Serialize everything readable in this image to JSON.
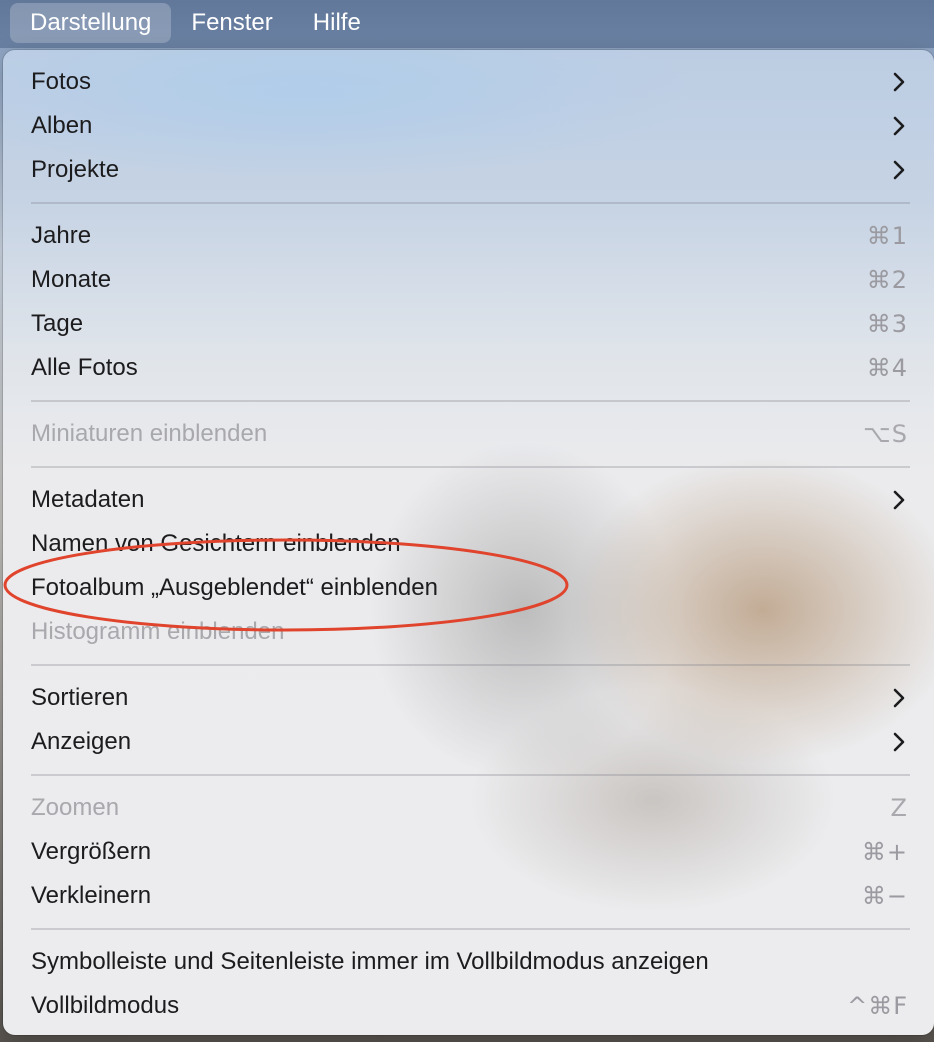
{
  "menubar": {
    "items": [
      {
        "label": "Darstellung"
      },
      {
        "label": "Fenster"
      },
      {
        "label": "Hilfe"
      }
    ]
  },
  "menu": {
    "items": [
      {
        "label": "Fotos",
        "submenu": true
      },
      {
        "label": "Alben",
        "submenu": true
      },
      {
        "label": "Projekte",
        "submenu": true
      },
      {
        "label": "Jahre",
        "shortcut": "⌘1"
      },
      {
        "label": "Monate",
        "shortcut": "⌘2"
      },
      {
        "label": "Tage",
        "shortcut": "⌘3"
      },
      {
        "label": "Alle Fotos",
        "shortcut": "⌘4"
      },
      {
        "label": "Miniaturen einblenden",
        "shortcut": "⌥S",
        "disabled": true
      },
      {
        "label": "Metadaten",
        "submenu": true
      },
      {
        "label": "Namen von Gesichtern einblenden"
      },
      {
        "label": "Fotoalbum „Ausgeblendet“ einblenden",
        "highlighted": true
      },
      {
        "label": "Histogramm einblenden",
        "disabled": true
      },
      {
        "label": "Sortieren",
        "submenu": true
      },
      {
        "label": "Anzeigen",
        "submenu": true
      },
      {
        "label": "Zoomen",
        "shortcut": "Z",
        "disabled": true
      },
      {
        "label": "Vergrößern",
        "shortcut": "⌘+"
      },
      {
        "label": "Verkleinern",
        "shortcut": "⌘−"
      },
      {
        "label": "Symbolleiste und Seitenleiste immer im Vollbildmodus anzeigen"
      },
      {
        "label": "Vollbildmodus",
        "shortcut": "^⌘F"
      }
    ]
  },
  "colors": {
    "annotation": "#e0442c",
    "menubar": "#647b9d"
  }
}
